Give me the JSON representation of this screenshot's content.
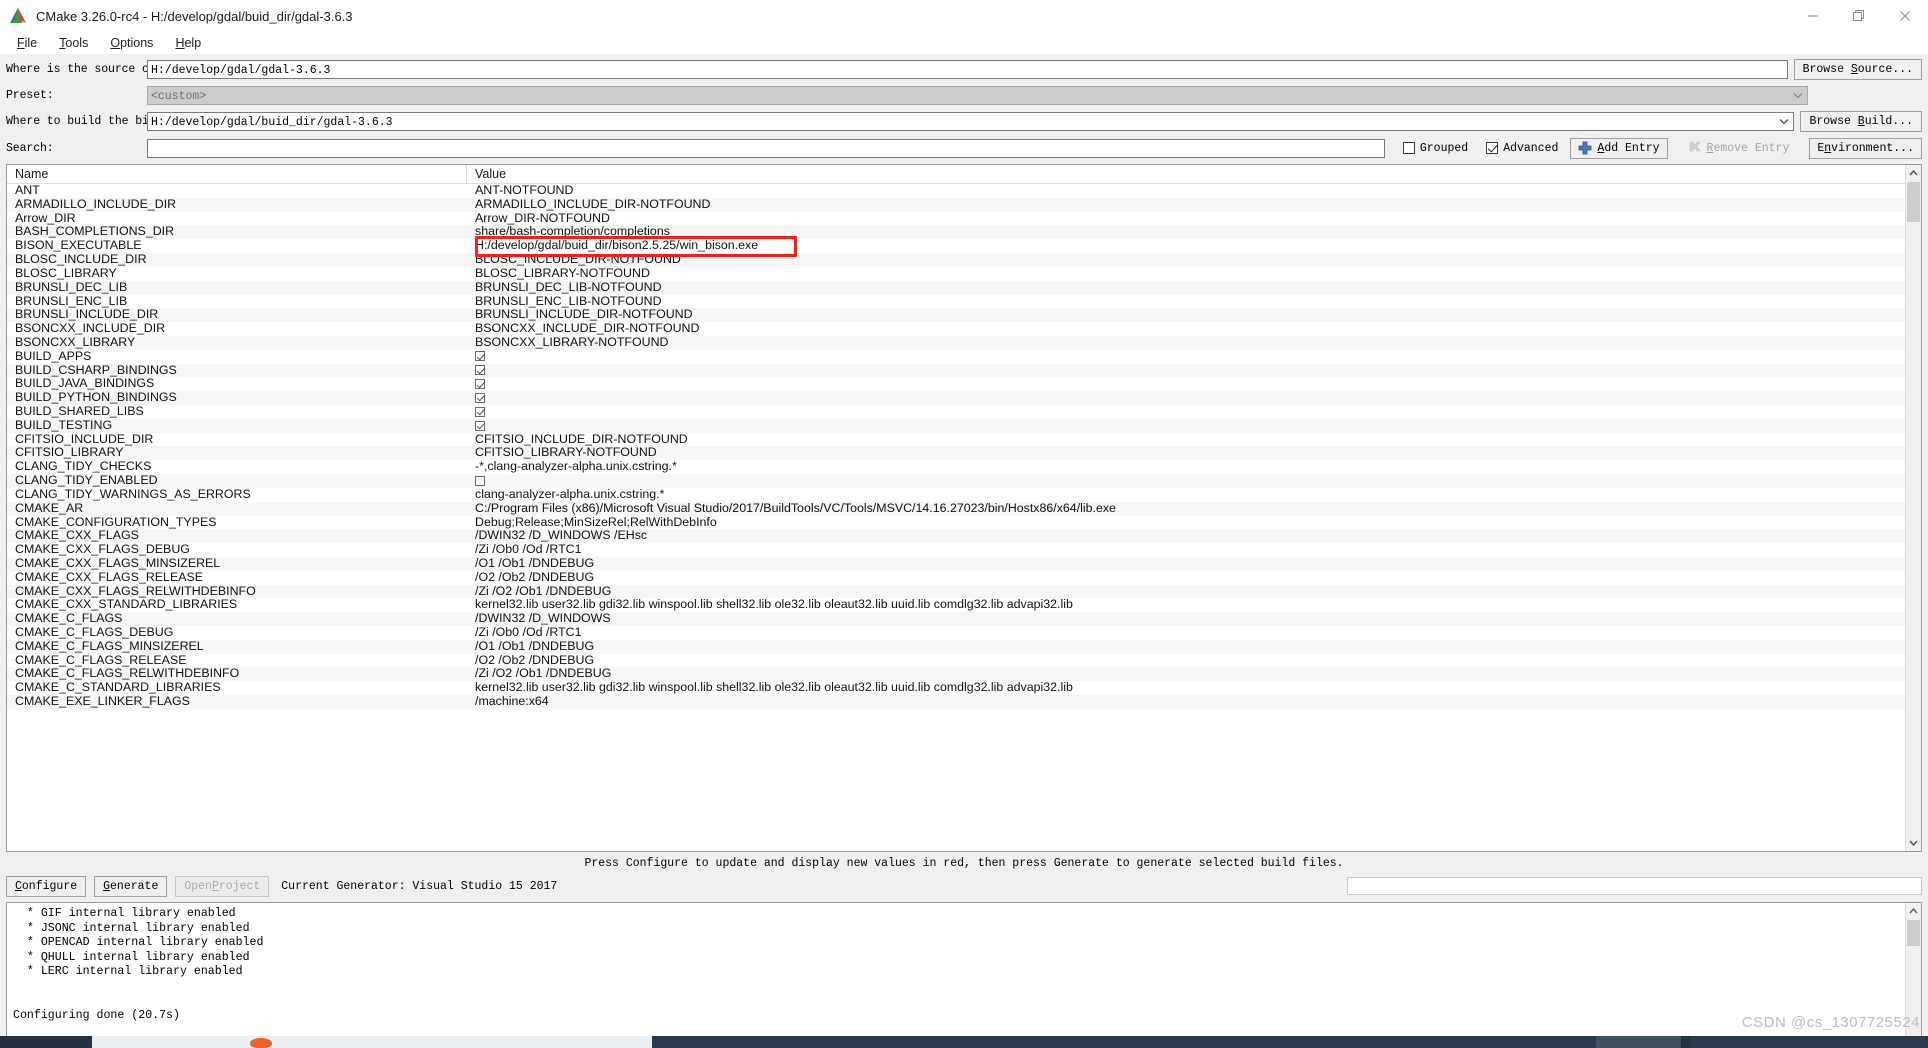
{
  "window": {
    "title": "CMake 3.26.0-rc4 - H:/develop/gdal/buid_dir/gdal-3.6.3",
    "icon": "cmake-logo-icon",
    "minimize": "—",
    "maximize": "❐",
    "close": "✕"
  },
  "menubar": {
    "items": [
      {
        "label": "File",
        "accel": "F"
      },
      {
        "label": "Tools",
        "accel": "T"
      },
      {
        "label": "Options",
        "accel": "O"
      },
      {
        "label": "Help",
        "accel": "H"
      }
    ]
  },
  "form": {
    "source_label": "Where is the source code:",
    "source_value": "H:/develop/gdal/gdal-3.6.3",
    "browse_source_label": "Browse Source...",
    "browse_source_accel": "S",
    "preset_label": "Preset:",
    "preset_value": "<custom>",
    "build_label": "Where to build the binaries:",
    "build_value": "H:/develop/gdal/buid_dir/gdal-3.6.3",
    "browse_build_label": "Browse Build...",
    "browse_build_accel": "B"
  },
  "search": {
    "label": "Search:",
    "value": "",
    "placeholder": "",
    "grouped_label": "Grouped",
    "grouped_checked": false,
    "advanced_label": "Advanced",
    "advanced_checked": true,
    "add_entry_label": "Add Entry",
    "add_entry_accel": "A",
    "remove_entry_label": "Remove Entry",
    "remove_entry_accel": "R",
    "remove_entry_disabled": true,
    "environment_label": "Environment...",
    "environment_accel": "n"
  },
  "table": {
    "columns": [
      "Name",
      "Value"
    ],
    "rows": [
      {
        "name": "ANT",
        "value": "ANT-NOTFOUND",
        "type": "text"
      },
      {
        "name": "ARMADILLO_INCLUDE_DIR",
        "value": "ARMADILLO_INCLUDE_DIR-NOTFOUND",
        "type": "text"
      },
      {
        "name": "Arrow_DIR",
        "value": "Arrow_DIR-NOTFOUND",
        "type": "text"
      },
      {
        "name": "BASH_COMPLETIONS_DIR",
        "value": "share/bash-completion/completions",
        "type": "text"
      },
      {
        "name": "BISON_EXECUTABLE",
        "value": "H:/develop/gdal/buid_dir/bison2.5.25/win_bison.exe",
        "type": "text",
        "highlighted": true
      },
      {
        "name": "BLOSC_INCLUDE_DIR",
        "value": "BLOSC_INCLUDE_DIR-NOTFOUND",
        "type": "text"
      },
      {
        "name": "BLOSC_LIBRARY",
        "value": "BLOSC_LIBRARY-NOTFOUND",
        "type": "text"
      },
      {
        "name": "BRUNSLI_DEC_LIB",
        "value": "BRUNSLI_DEC_LIB-NOTFOUND",
        "type": "text"
      },
      {
        "name": "BRUNSLI_ENC_LIB",
        "value": "BRUNSLI_ENC_LIB-NOTFOUND",
        "type": "text"
      },
      {
        "name": "BRUNSLI_INCLUDE_DIR",
        "value": "BRUNSLI_INCLUDE_DIR-NOTFOUND",
        "type": "text"
      },
      {
        "name": "BSONCXX_INCLUDE_DIR",
        "value": "BSONCXX_INCLUDE_DIR-NOTFOUND",
        "type": "text"
      },
      {
        "name": "BSONCXX_LIBRARY",
        "value": "BSONCXX_LIBRARY-NOTFOUND",
        "type": "text"
      },
      {
        "name": "BUILD_APPS",
        "value": "",
        "type": "checkbox",
        "checked": true
      },
      {
        "name": "BUILD_CSHARP_BINDINGS",
        "value": "",
        "type": "checkbox",
        "checked": true
      },
      {
        "name": "BUILD_JAVA_BINDINGS",
        "value": "",
        "type": "checkbox",
        "checked": true
      },
      {
        "name": "BUILD_PYTHON_BINDINGS",
        "value": "",
        "type": "checkbox",
        "checked": true
      },
      {
        "name": "BUILD_SHARED_LIBS",
        "value": "",
        "type": "checkbox",
        "checked": true
      },
      {
        "name": "BUILD_TESTING",
        "value": "",
        "type": "checkbox",
        "checked": true
      },
      {
        "name": "CFITSIO_INCLUDE_DIR",
        "value": "CFITSIO_INCLUDE_DIR-NOTFOUND",
        "type": "text"
      },
      {
        "name": "CFITSIO_LIBRARY",
        "value": "CFITSIO_LIBRARY-NOTFOUND",
        "type": "text"
      },
      {
        "name": "CLANG_TIDY_CHECKS",
        "value": "-*,clang-analyzer-alpha.unix.cstring.*",
        "type": "text"
      },
      {
        "name": "CLANG_TIDY_ENABLED",
        "value": "",
        "type": "checkbox",
        "checked": false
      },
      {
        "name": "CLANG_TIDY_WARNINGS_AS_ERRORS",
        "value": "clang-analyzer-alpha.unix.cstring.*",
        "type": "text"
      },
      {
        "name": "CMAKE_AR",
        "value": "C:/Program Files (x86)/Microsoft Visual Studio/2017/BuildTools/VC/Tools/MSVC/14.16.27023/bin/Hostx86/x64/lib.exe",
        "type": "text"
      },
      {
        "name": "CMAKE_CONFIGURATION_TYPES",
        "value": "Debug;Release;MinSizeRel;RelWithDebInfo",
        "type": "text"
      },
      {
        "name": "CMAKE_CXX_FLAGS",
        "value": "/DWIN32 /D_WINDOWS /EHsc",
        "type": "text"
      },
      {
        "name": "CMAKE_CXX_FLAGS_DEBUG",
        "value": "/Zi /Ob0 /Od /RTC1",
        "type": "text"
      },
      {
        "name": "CMAKE_CXX_FLAGS_MINSIZEREL",
        "value": "/O1 /Ob1 /DNDEBUG",
        "type": "text"
      },
      {
        "name": "CMAKE_CXX_FLAGS_RELEASE",
        "value": "/O2 /Ob2 /DNDEBUG",
        "type": "text"
      },
      {
        "name": "CMAKE_CXX_FLAGS_RELWITHDEBINFO",
        "value": "/Zi /O2 /Ob1 /DNDEBUG",
        "type": "text"
      },
      {
        "name": "CMAKE_CXX_STANDARD_LIBRARIES",
        "value": "kernel32.lib user32.lib gdi32.lib winspool.lib shell32.lib ole32.lib oleaut32.lib uuid.lib comdlg32.lib advapi32.lib",
        "type": "text"
      },
      {
        "name": "CMAKE_C_FLAGS",
        "value": "/DWIN32 /D_WINDOWS",
        "type": "text"
      },
      {
        "name": "CMAKE_C_FLAGS_DEBUG",
        "value": "/Zi /Ob0 /Od /RTC1",
        "type": "text"
      },
      {
        "name": "CMAKE_C_FLAGS_MINSIZEREL",
        "value": "/O1 /Ob1 /DNDEBUG",
        "type": "text"
      },
      {
        "name": "CMAKE_C_FLAGS_RELEASE",
        "value": "/O2 /Ob2 /DNDEBUG",
        "type": "text"
      },
      {
        "name": "CMAKE_C_FLAGS_RELWITHDEBINFO",
        "value": "/Zi /O2 /Ob1 /DNDEBUG",
        "type": "text"
      },
      {
        "name": "CMAKE_C_STANDARD_LIBRARIES",
        "value": "kernel32.lib user32.lib gdi32.lib winspool.lib shell32.lib ole32.lib oleaut32.lib uuid.lib comdlg32.lib advapi32.lib",
        "type": "text"
      },
      {
        "name": "CMAKE_EXE_LINKER_FLAGS",
        "value": "/machine:x64",
        "type": "text"
      }
    ]
  },
  "hint": "Press Configure to update and display new values in red, then press Generate to generate selected build files.",
  "actions": {
    "configure_label": "Configure",
    "configure_accel": "C",
    "generate_label": "Generate",
    "generate_accel": "G",
    "open_project_label": "Open Project",
    "open_project_accel": "P",
    "open_project_disabled": true,
    "generator_text": "Current Generator: Visual Studio 15 2017"
  },
  "log": {
    "lines": [
      "  * GIF internal library enabled",
      "  * JSONC internal library enabled",
      "  * OPENCAD internal library enabled",
      "  * QHULL internal library enabled",
      "  * LERC internal library enabled",
      "",
      "",
      "Configuring done (20.7s)"
    ]
  },
  "watermark": "CSDN @cs_1307725524",
  "colors": {
    "annotation_red": "#fb1d16",
    "window_bg": "#f0f0f0",
    "row_alt": "#f6f6f6",
    "taskbar": "#26323f"
  }
}
